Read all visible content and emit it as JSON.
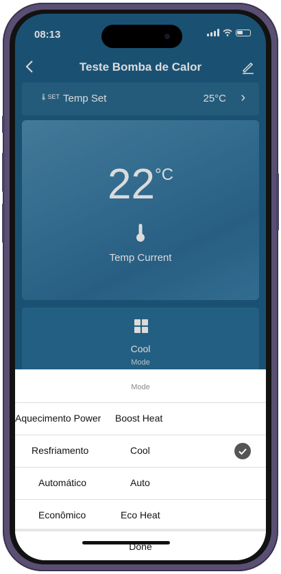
{
  "status_bar": {
    "time": "08:13"
  },
  "nav": {
    "title": "Teste Bomba de Calor",
    "back_icon": "chevron-left-icon",
    "edit_icon": "pencil-icon"
  },
  "temp_set": {
    "icon_text": "SET",
    "label": "Temp Set",
    "value": "25°C"
  },
  "temp_card": {
    "value": "22",
    "unit": "°C",
    "caption": "Temp Current"
  },
  "mode_panel": {
    "current": "Cool",
    "label": "Mode"
  },
  "mode_sheet": {
    "title": "Mode",
    "options": [
      {
        "pt": "Aquecimento Power",
        "en": "Boost Heat",
        "selected": false
      },
      {
        "pt": "Resfriamento",
        "en": "Cool",
        "selected": true
      },
      {
        "pt": "Automático",
        "en": "Auto",
        "selected": false
      },
      {
        "pt": "Econômico",
        "en": "Eco Heat",
        "selected": false
      }
    ],
    "done_label": "Done"
  },
  "colors": {
    "background": "#1f5f86",
    "sheet": "#ffffff",
    "check": "#555555"
  }
}
